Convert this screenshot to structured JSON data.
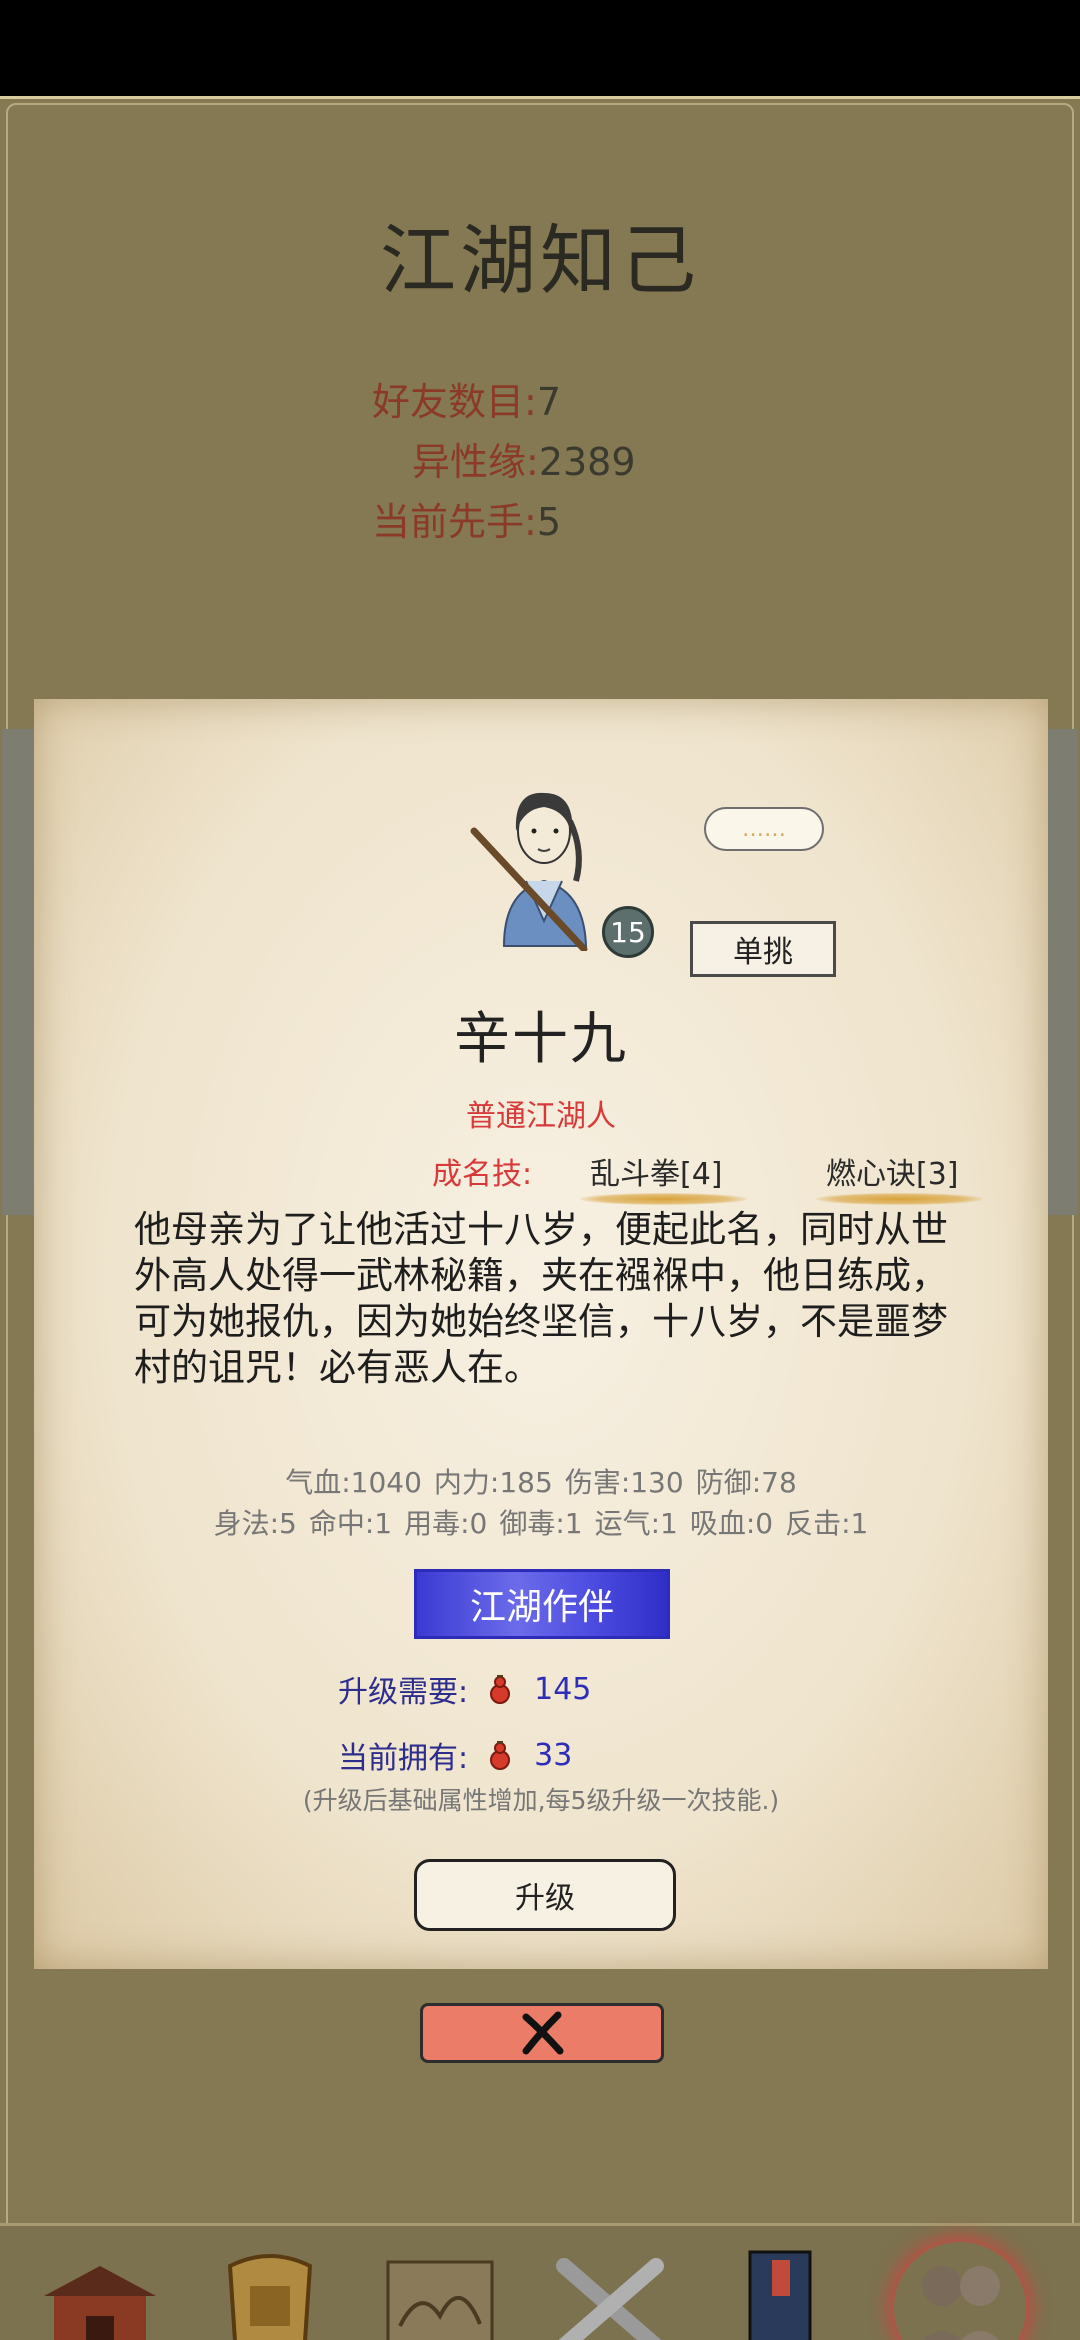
{
  "header": {
    "title": "江湖知己"
  },
  "stats": {
    "friends_label": "好友数目:",
    "friends_value": "7",
    "charm_label": "异性缘:",
    "charm_value": "2389",
    "initiative_label": "当前先手:",
    "initiative_value": "5"
  },
  "character": {
    "level": "15",
    "speech": "……",
    "duel_label": "单挑",
    "name": "辛十九",
    "title": "普通江湖人",
    "skills_label": "成名技:",
    "skills": [
      "乱斗拳[4]",
      "燃心诀[3]"
    ],
    "bio": "他母亲为了让他活过十八岁，便起此名，同时从世外高人处得一武林秘籍，夹在襁褓中，他日练成，可为她报仇，因为她始终坚信，十八岁，不是噩梦村的诅咒！必有恶人在。",
    "attrs_row1": [
      "气血:1040",
      "内力:185",
      "伤害:130",
      "防御:78"
    ],
    "attrs_row2": [
      "身法:5",
      "命中:1",
      "用毒:0",
      "御毒:1",
      "运气:1",
      "吸血:0",
      "反击:1"
    ]
  },
  "actions": {
    "companion_label": "江湖作伴",
    "upgrade_cost_label": "升级需要:",
    "upgrade_cost_value": "145",
    "owned_label": "当前拥有:",
    "owned_value": "33",
    "note": "(升级后基础属性增加,每5级升级一次技能.)",
    "upgrade_label": "升级"
  },
  "nav": {
    "items": [
      {
        "label": "首页",
        "icon": "house-icon"
      },
      {
        "label": "装备",
        "icon": "armor-icon"
      },
      {
        "label": "江湖",
        "icon": "map-scroll-icon"
      },
      {
        "label": "闯关",
        "icon": "crossed-swords-icon"
      },
      {
        "label": "武功",
        "icon": "book-icon"
      },
      {
        "label": "伙伴",
        "icon": "companions-icon"
      }
    ],
    "active": "伙伴"
  },
  "colors": {
    "background": "#857954",
    "accent_red": "#d83a3a",
    "button_blue": "#3b3bd4",
    "close_button": "#ea7c68",
    "nav_gold": "#d6a72c"
  }
}
